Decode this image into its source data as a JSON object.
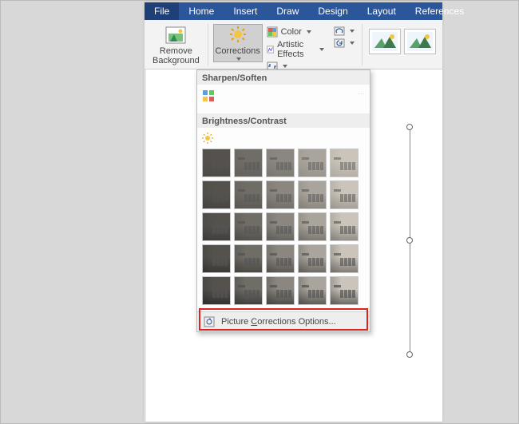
{
  "menu": {
    "tabs": [
      "File",
      "Home",
      "Insert",
      "Draw",
      "Design",
      "Layout",
      "References"
    ]
  },
  "ribbon": {
    "remove_bg": "Remove\nBackground",
    "corrections": "Corrections",
    "color": "Color",
    "artistic": "Artistic Effects"
  },
  "gallery": {
    "section_sharpen": "Sharpen/Soften",
    "section_bc": "Brightness/Contrast",
    "footer_prefix": "Picture ",
    "footer_u": "C",
    "footer_suffix": "orrections Options...",
    "rows": 5,
    "cols": 5,
    "brightness_steps": [
      0.25,
      0.4,
      0.55,
      0.72,
      0.9
    ],
    "contrast_steps": [
      0.55,
      0.7,
      0.85,
      1.0,
      1.15
    ]
  }
}
